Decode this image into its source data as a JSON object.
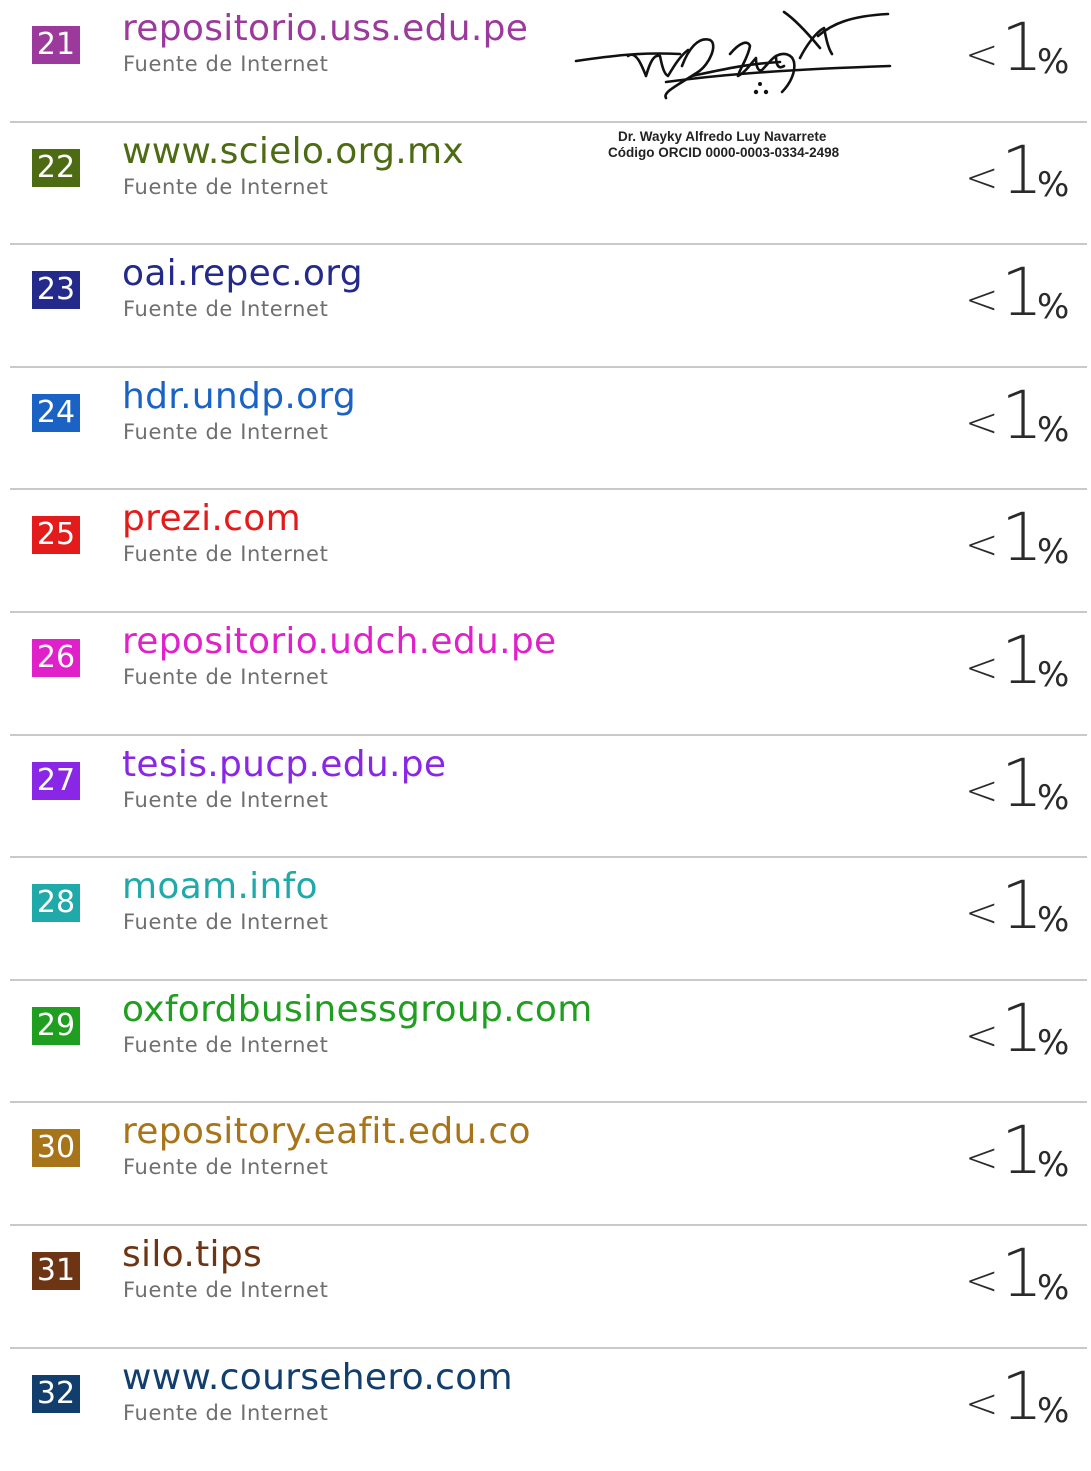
{
  "sources": [
    {
      "number": "21",
      "name": "repositorio.uss.edu.pe",
      "kind": "Fuente de Internet",
      "percent_prefix": "<",
      "percent_value": "1",
      "percent_sign": "%",
      "color": "#9b3a9c"
    },
    {
      "number": "22",
      "name": "www.scielo.org.mx",
      "kind": "Fuente de Internet",
      "percent_prefix": "<",
      "percent_value": "1",
      "percent_sign": "%",
      "color": "#4d6b12"
    },
    {
      "number": "23",
      "name": "oai.repec.org",
      "kind": "Fuente de Internet",
      "percent_prefix": "<",
      "percent_value": "1",
      "percent_sign": "%",
      "color": "#242a8c"
    },
    {
      "number": "24",
      "name": "hdr.undp.org",
      "kind": "Fuente de Internet",
      "percent_prefix": "<",
      "percent_value": "1",
      "percent_sign": "%",
      "color": "#1a63c4"
    },
    {
      "number": "25",
      "name": "prezi.com",
      "kind": "Fuente de Internet",
      "percent_prefix": "<",
      "percent_value": "1",
      "percent_sign": "%",
      "color": "#e41b1b"
    },
    {
      "number": "26",
      "name": "repositorio.udch.edu.pe",
      "kind": "Fuente de Internet",
      "percent_prefix": "<",
      "percent_value": "1",
      "percent_sign": "%",
      "color": "#e021c9"
    },
    {
      "number": "27",
      "name": "tesis.pucp.edu.pe",
      "kind": "Fuente de Internet",
      "percent_prefix": "<",
      "percent_value": "1",
      "percent_sign": "%",
      "color": "#8a26e6"
    },
    {
      "number": "28",
      "name": "moam.info",
      "kind": "Fuente de Internet",
      "percent_prefix": "<",
      "percent_value": "1",
      "percent_sign": "%",
      "color": "#20a9a9"
    },
    {
      "number": "29",
      "name": "oxfordbusinessgroup.com",
      "kind": "Fuente de Internet",
      "percent_prefix": "<",
      "percent_value": "1",
      "percent_sign": "%",
      "color": "#1f9e1f"
    },
    {
      "number": "30",
      "name": "repository.eafit.edu.co",
      "kind": "Fuente de Internet",
      "percent_prefix": "<",
      "percent_value": "1",
      "percent_sign": "%",
      "color": "#a8741a"
    },
    {
      "number": "31",
      "name": "silo.tips",
      "kind": "Fuente de Internet",
      "percent_prefix": "<",
      "percent_value": "1",
      "percent_sign": "%",
      "color": "#6e3514"
    },
    {
      "number": "32",
      "name": "www.coursehero.com",
      "kind": "Fuente de Internet",
      "percent_prefix": "<",
      "percent_value": "1",
      "percent_sign": "%",
      "color": "#123e6e"
    }
  ],
  "signature": {
    "name": "Dr. Wayky Alfredo Luy Navarrete",
    "orcid": "Código ORCID 0000-0003-0334-2498"
  }
}
